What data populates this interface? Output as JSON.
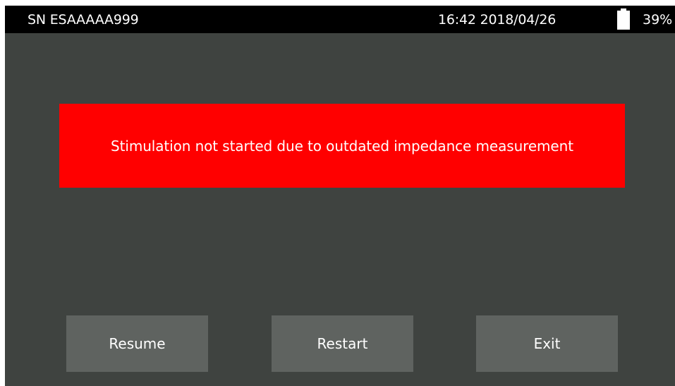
{
  "status_bar": {
    "serial": "SN ESAAAAA999",
    "datetime": "16:42 2018/04/26",
    "battery_percent": "39%",
    "battery_icon": "battery-icon"
  },
  "alert": {
    "message": "Stimulation not started due to outdated impedance measurement",
    "color": "#ff0000"
  },
  "buttons": {
    "resume": "Resume",
    "restart": "Restart",
    "exit": "Exit"
  }
}
